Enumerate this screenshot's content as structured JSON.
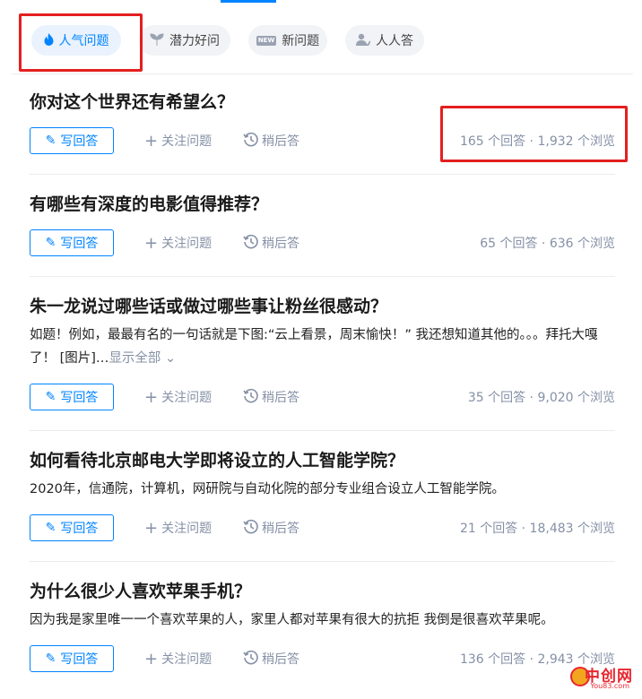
{
  "tabs": [
    {
      "label": "人气问题",
      "icon": "flame-icon",
      "active": true
    },
    {
      "label": "潜力好问",
      "icon": "sprout-icon",
      "active": false
    },
    {
      "label": "新问题",
      "icon": "new-badge-icon",
      "badge": "NEW",
      "active": false
    },
    {
      "label": "人人答",
      "icon": "people-icon",
      "active": false
    }
  ],
  "actions": {
    "write": "写回答",
    "follow": "关注问题",
    "later": "稍后答",
    "plus_glyph": "+",
    "pencil_glyph": "✎"
  },
  "questions": [
    {
      "title": "你对这个世界还有希望么？",
      "stats": "165 个回答 · 1,932 个浏览"
    },
    {
      "title": "有哪些有深度的电影值得推荐？",
      "stats": "65 个回答 · 636 个浏览"
    },
    {
      "title": "朱一龙说过哪些话或做过哪些事让粉丝很感动？",
      "excerpt": "如题！例如，最最有名的一句话就是下图:“云上看景，周末愉快！” 我还想知道其他的。。。拜托大嘎了！ [图片]…",
      "more": "显示全部 ⌄",
      "stats": "35 个回答 · 9,020 个浏览"
    },
    {
      "title": "如何看待北京邮电大学即将设立的人工智能学院？",
      "excerpt": "2020年，信通院，计算机，网研院与自动化院的部分专业组合设立人工智能学院。",
      "stats": "21 个回答 · 18,483 个浏览"
    },
    {
      "title": "为什么很少人喜欢苹果手机？",
      "excerpt": "因为我是家里唯一一个喜欢苹果的人，家里人都对苹果有很大的抗拒 我倒是很喜欢苹果呢。",
      "stats": "136 个回答 · 2,943 个浏览"
    }
  ],
  "watermark": {
    "text": "中创网",
    "sub": "You83.com"
  },
  "colors": {
    "accent": "#0084ff",
    "highlight": "#e41f1f",
    "muted": "#8590a6"
  }
}
